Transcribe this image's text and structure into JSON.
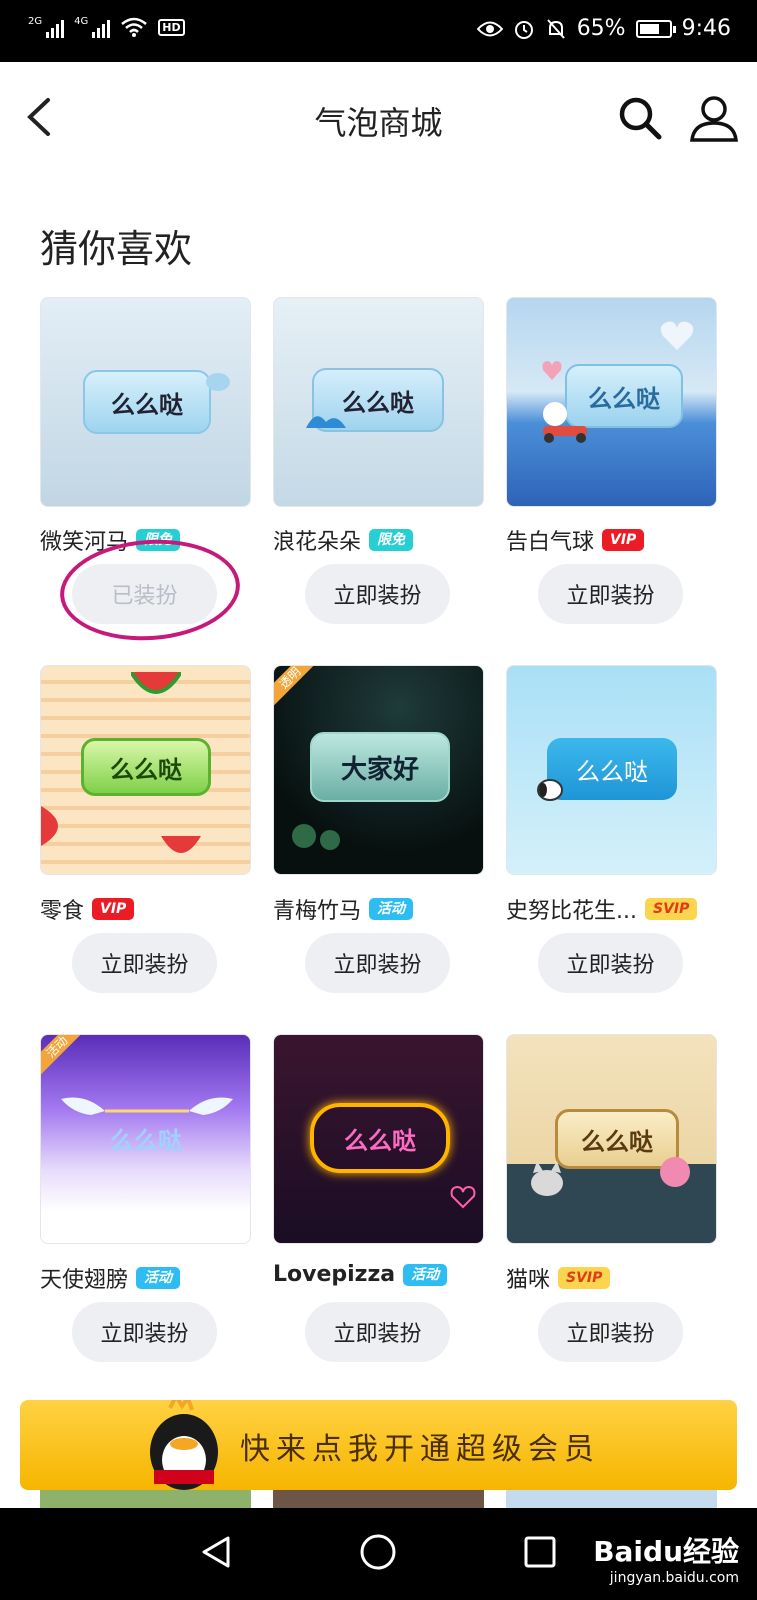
{
  "status": {
    "left_net1": "2G",
    "left_net2": "4G",
    "hd": "HD",
    "battery": "65%",
    "time": "9:46"
  },
  "nav": {
    "title": "气泡商城"
  },
  "section": {
    "title": "猜你喜欢"
  },
  "bubble_text_default": "么么哒",
  "items": [
    {
      "name": "微笑河马",
      "badge": "限免",
      "bubble": "么么哒",
      "button": "已装扮"
    },
    {
      "name": "浪花朵朵",
      "badge": "限免",
      "bubble": "么么哒",
      "button": "立即装扮"
    },
    {
      "name": "告白气球",
      "badge": "VIP",
      "bubble": "么么哒",
      "button": "立即装扮"
    },
    {
      "name": "零食",
      "badge": "VIP",
      "bubble": "么么哒",
      "button": "立即装扮"
    },
    {
      "name": "青梅竹马",
      "badge": "活动",
      "bubble": "大家好",
      "button": "立即装扮",
      "corner": "透明"
    },
    {
      "name": "史努比花生...",
      "badge": "SVIP",
      "bubble": "么么哒",
      "button": "立即装扮"
    },
    {
      "name": "天使翅膀",
      "badge": "活动",
      "bubble": "么么哒",
      "button": "立即装扮",
      "corner": "活动"
    },
    {
      "name": "Lovepizza",
      "badge": "活动",
      "bubble": "么么哒",
      "button": "立即装扮"
    },
    {
      "name": "猫咪",
      "badge": "SVIP",
      "bubble": "么么哒",
      "button": "立即装扮"
    }
  ],
  "promo": {
    "text": "快来点我开通超级会员"
  },
  "watermark": {
    "brand": "Baidu经验",
    "url": "jingyan.baidu.com"
  },
  "colors": {
    "badge_free": "#27cfd4",
    "badge_vip": "#ec1c24",
    "badge_activity": "#2dbdf2",
    "badge_svip": "#fbd54e",
    "annotation_circle": "#c6197c"
  }
}
